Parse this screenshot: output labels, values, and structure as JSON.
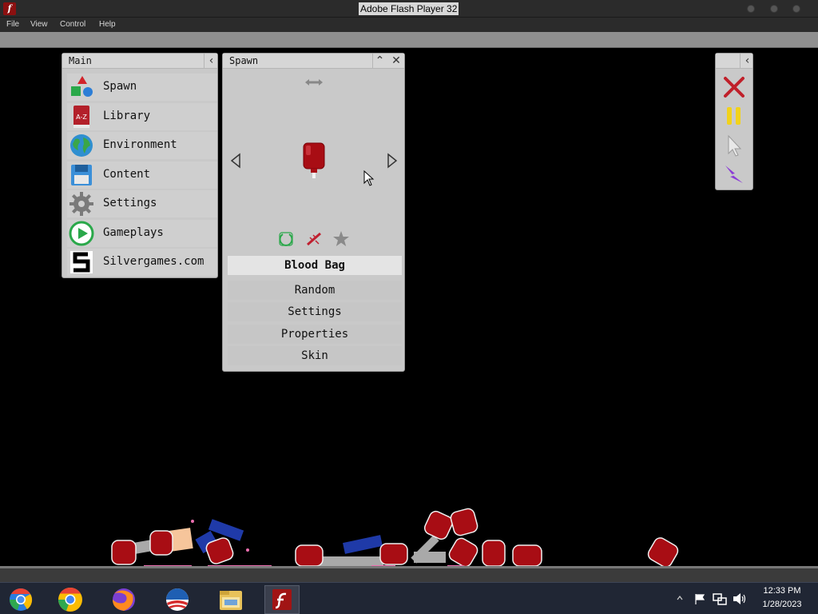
{
  "window": {
    "title": "Adobe Flash Player 32",
    "menu": [
      "File",
      "View",
      "Control",
      "Help"
    ]
  },
  "main_panel": {
    "title": "Main",
    "items": [
      {
        "label": "Spawn",
        "icon": "shapes-icon"
      },
      {
        "label": "Library",
        "icon": "book-icon"
      },
      {
        "label": "Environment",
        "icon": "globe-icon"
      },
      {
        "label": "Content",
        "icon": "floppy-disk-icon"
      },
      {
        "label": "Settings",
        "icon": "gear-icon"
      },
      {
        "label": "Gameplays",
        "icon": "play-icon"
      },
      {
        "label": "Silvergames.com",
        "icon": "silvergames-logo-icon"
      }
    ]
  },
  "icon_text": {
    "library_book": "A-Z"
  },
  "spawn_panel": {
    "title": "Spawn",
    "selected_item": "Blood Bag",
    "options": [
      "Random",
      "Settings",
      "Properties",
      "Skin"
    ]
  },
  "toolbar": {
    "tools": [
      "close-x-icon",
      "pause-icon",
      "cursor-icon",
      "lightning-icon"
    ]
  },
  "taskbar": {
    "apps": [
      "chrome-icon",
      "chrome-icon",
      "firefox-icon",
      "obama-logo-icon",
      "file-explorer-icon",
      "flash-player-icon"
    ],
    "time": "12:33 PM",
    "date": "1/28/2023"
  },
  "colors": {
    "blood_red": "#a80d14",
    "panel_bg": "#c9c9c9",
    "taskbar": "#202634",
    "accent_yellow": "#f2d21b",
    "accent_purple": "#8b3bd6"
  }
}
